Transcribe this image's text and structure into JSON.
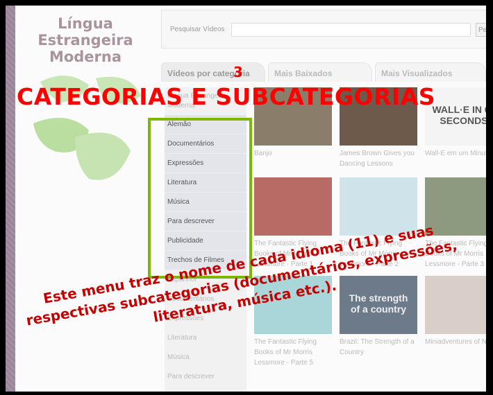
{
  "logo": {
    "line1": "Língua",
    "line2": "Estrangeira",
    "line3": "Moderna"
  },
  "search": {
    "label": "Pesquisar Vídeos",
    "value": "",
    "button": "Pe"
  },
  "tabs": [
    {
      "label": "Vídeos por categoria",
      "active": true
    },
    {
      "label": "Mais Baixados"
    },
    {
      "label": "Mais Visualizados"
    }
  ],
  "sidebar": {
    "category": "Língua Estrangeira Moderna",
    "highlighted": [
      "Alemão",
      "Documentários",
      "Expressões",
      "Literatura",
      "Música",
      "Para descrever",
      "Publicidade",
      "Trechos de Filmes"
    ],
    "after": [
      "Espanhol",
      "Documentários",
      "Expressões",
      "Literatura",
      "Música",
      "Para descrever"
    ]
  },
  "videos": [
    {
      "title": "Banjo",
      "color": "#8a7d6a"
    },
    {
      "title": "James Brown Gives you Dancing Lessons",
      "color": "#6e5a4a"
    },
    {
      "title": "Wall-E em um Minuto",
      "color": "#f4f4f4",
      "thumb_text": "WALL·E IN 60 SECONDS"
    },
    {
      "title": "The Fantastic Flying Books of Mr Morris Lessmore - Parte 1",
      "color": "#b86a64"
    },
    {
      "title": "The Fantastic Flying Books of Mr Morris Lessmore - Parte 2",
      "color": "#cfe3ea"
    },
    {
      "title": "The Fantastic Flying Books of Mr Morris Lessmore - Parte 3",
      "color": "#8e9a80"
    },
    {
      "title": "The Fantastic Flying Books of Mr Morris Lessmore - Parte 5",
      "color": "#a9d6d8"
    },
    {
      "title": "Brazil: The Strength of a Country",
      "color": "#6d7a8a",
      "thumb_text": "The strength of a country"
    },
    {
      "title": "Miniadventures of N",
      "color": "#d9cfc8"
    }
  ],
  "annotation": {
    "number": "3",
    "title": "CATEGORIAS E SUBCATEGORIAS",
    "note_line1": "Este menu traz o nome de cada idioma (11) e suas",
    "note_line2": "respectivas subcategorias (documentários, expressões,",
    "note_line3": "literatura, música etc.).",
    "color": "#ff0000",
    "highlight_color": "#7db800"
  }
}
